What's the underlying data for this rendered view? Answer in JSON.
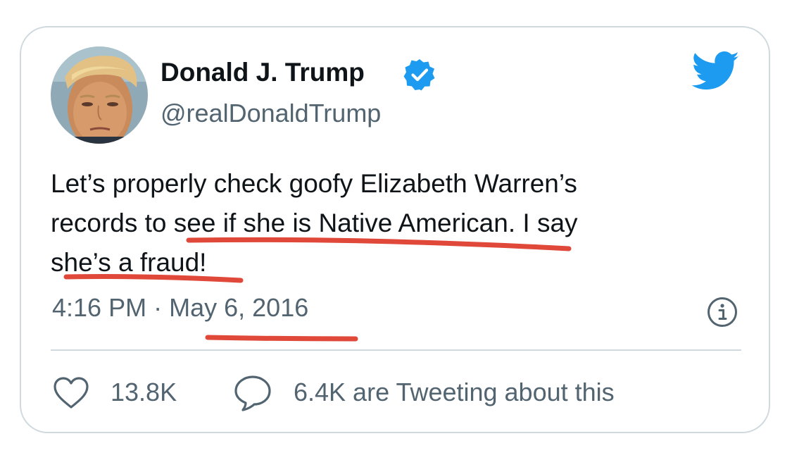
{
  "tweet": {
    "author": {
      "display_name": "Donald J. Trump",
      "handle": "@realDonaldTrump",
      "verified": true,
      "avatar_icon": "profile-photo"
    },
    "text_lines": [
      "Let’s properly check goofy Elizabeth Warren’s",
      "records to see if she is Native American. I say",
      "she’s a fraud!"
    ],
    "time": "4:16 PM",
    "separator": "·",
    "date": "May 6, 2016",
    "likes": "13.8K",
    "tweeting": "6.4K are Tweeting about this"
  },
  "icons": {
    "brand": "twitter-bird-icon",
    "verified": "verified-badge-icon",
    "info": "info-icon",
    "like": "heart-icon",
    "reply": "speech-bubble-icon"
  },
  "colors": {
    "twitter_blue": "#1d9bf0",
    "text": "#0f1419",
    "secondary_text": "#536471",
    "border": "#cfd9de",
    "annotation_red": "#e0483a"
  },
  "annotations": {
    "type": "hand-drawn red underlines",
    "underlined_phrases": [
      "see if she is Native American.",
      "she’s a fraud!",
      "May 6, 2016"
    ]
  }
}
